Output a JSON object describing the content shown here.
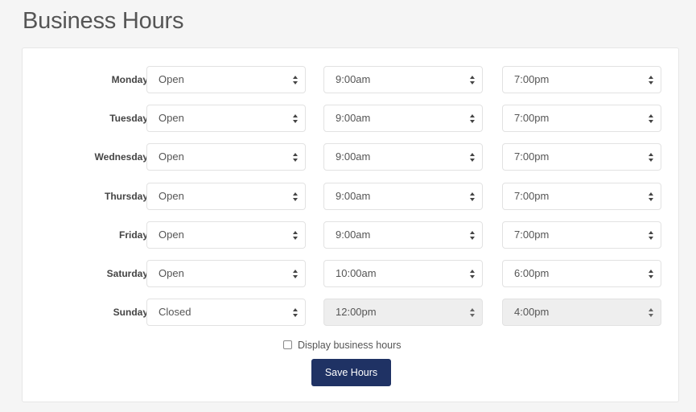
{
  "page": {
    "title": "Business Hours"
  },
  "days": [
    {
      "label": "Monday:",
      "status": "Open",
      "open": "9:00am",
      "close": "7:00pm",
      "times_disabled": false
    },
    {
      "label": "Tuesday:",
      "status": "Open",
      "open": "9:00am",
      "close": "7:00pm",
      "times_disabled": false
    },
    {
      "label": "Wednesday:",
      "status": "Open",
      "open": "9:00am",
      "close": "7:00pm",
      "times_disabled": false
    },
    {
      "label": "Thursday:",
      "status": "Open",
      "open": "9:00am",
      "close": "7:00pm",
      "times_disabled": false
    },
    {
      "label": "Friday:",
      "status": "Open",
      "open": "9:00am",
      "close": "7:00pm",
      "times_disabled": false
    },
    {
      "label": "Saturday:",
      "status": "Open",
      "open": "10:00am",
      "close": "6:00pm",
      "times_disabled": false
    },
    {
      "label": "Sunday:",
      "status": "Closed",
      "open": "12:00pm",
      "close": "4:00pm",
      "times_disabled": true
    }
  ],
  "display_toggle": {
    "label": "Display business hours",
    "checked": false
  },
  "save_button": {
    "label": "Save Hours",
    "color": "#1f3264"
  },
  "icons": {
    "select_caret": "sort-arrows-icon",
    "checkbox": "checkbox-icon"
  }
}
